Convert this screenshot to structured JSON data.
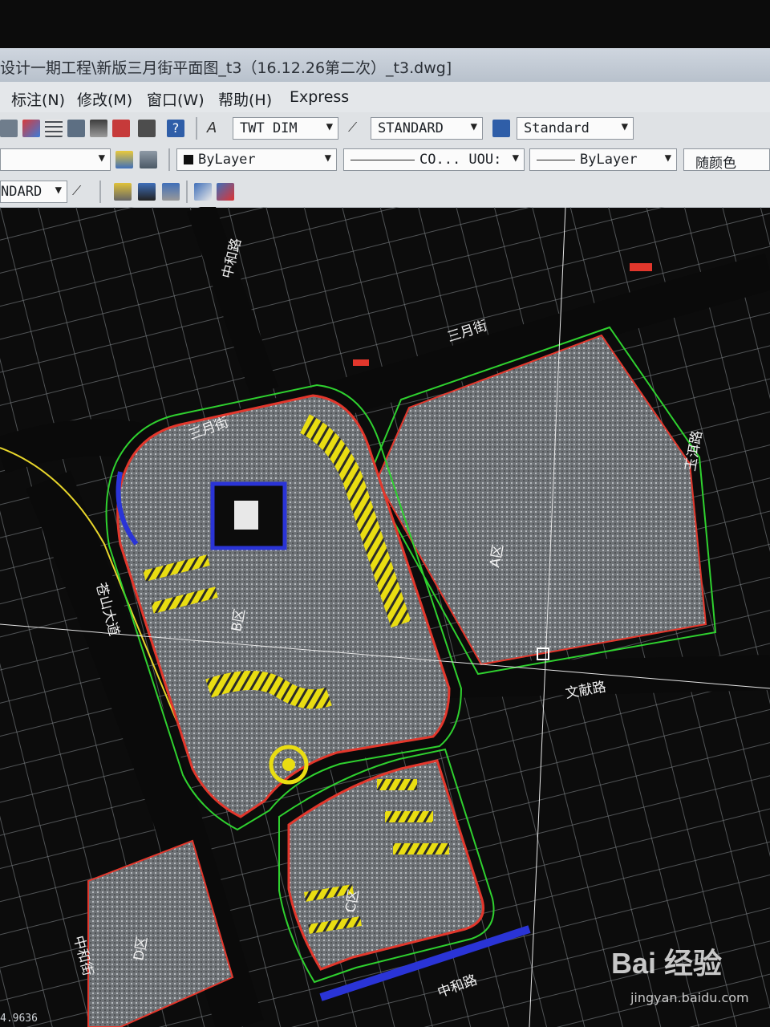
{
  "window": {
    "title": "设计一期工程\\新版三月街平面图_t3（16.12.26第二次）_t3.dwg]"
  },
  "menu": [
    {
      "label": "标注(N)"
    },
    {
      "label": "修改(M)"
    },
    {
      "label": "窗口(W)"
    },
    {
      "label": "帮助(H)"
    },
    {
      "label": "Express"
    }
  ],
  "toolbar": {
    "text_style": "TWT DIM",
    "dim_style": "STANDARD",
    "table_style": "Standard",
    "color": "ByLayer",
    "linetype": "CO... UOU:",
    "lineweight": "ByLayer",
    "plot_style": "随颜色",
    "mleader_style": "NDARD"
  },
  "drawing": {
    "labels": {
      "road_north": "中和路",
      "road_sanyue_1": "三月街",
      "road_sanyue_2": "三月街",
      "road_east": "玉洱路",
      "road_cangshan": "苍山大道",
      "road_wenxian": "文献路",
      "road_zhonghe_south": "中和路",
      "road_zhonghe_west": "中和街",
      "zone_a": "A区",
      "zone_b": "B区",
      "zone_c": "C区",
      "zone_d": "D区"
    }
  },
  "status": {
    "coordinate": "4.9636"
  },
  "watermark": {
    "brand": "Bai 经验",
    "url": "jingyan.baidu.com"
  },
  "colors": {
    "background": "#0c0c0c",
    "hatch": "#8e9296",
    "green": "#2fd12f",
    "yellow": "#f3e81a",
    "red": "#e2372c",
    "blue": "#2a34d6",
    "cyan": "#29d2e0"
  }
}
